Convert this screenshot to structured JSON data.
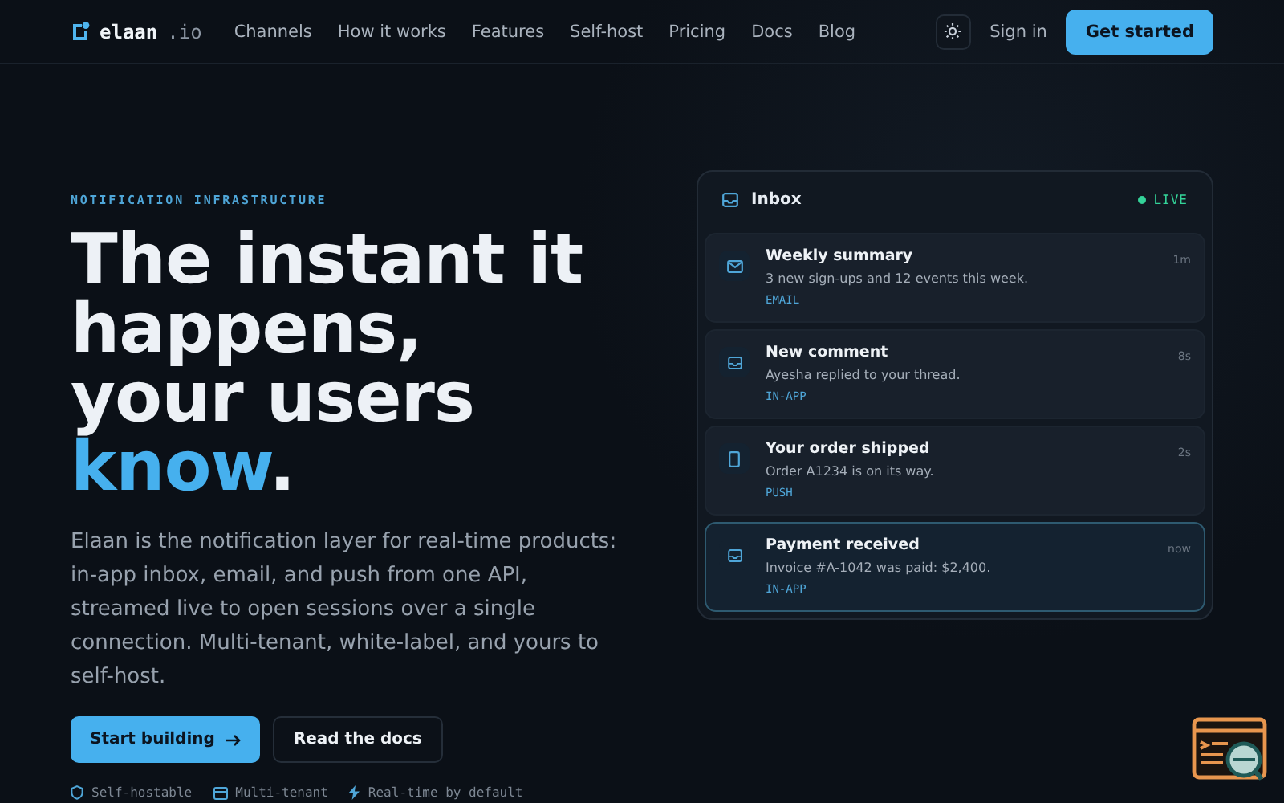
{
  "nav": {
    "logo": {
      "name": "elaan",
      "suffix": ".io"
    },
    "links": [
      "Channels",
      "How it works",
      "Features",
      "Self-host",
      "Pricing",
      "Docs",
      "Blog"
    ],
    "sign_in": "Sign in",
    "cta": "Get started"
  },
  "hero": {
    "eyebrow": "NOTIFICATION INFRASTRUCTURE",
    "headline": {
      "before": "The instant it happens, your users ",
      "highlight": "know",
      "after": "."
    },
    "description": "Elaan is the notification layer for real-time products: in-app inbox, email, and push from one API, streamed live to open sessions over a single connection. Multi-tenant, white-label, and yours to self-host.",
    "buttons": [
      {
        "label": "Start building",
        "kind": "primary"
      },
      {
        "label": "Read the docs",
        "kind": "secondary"
      }
    ],
    "features": [
      {
        "label": "Self-hostable",
        "kind": "shield"
      },
      {
        "label": "Multi-tenant",
        "kind": "tenant"
      },
      {
        "label": "Real-time by default",
        "kind": "bolt"
      }
    ]
  },
  "inbox": {
    "title": "Inbox",
    "status": "LIVE",
    "notifications": [
      {
        "title": "Weekly summary",
        "body": "3 new sign-ups and 12 events this week.",
        "channel": "EMAIL",
        "kind": "email",
        "time": "1m",
        "selected": false
      },
      {
        "title": "New comment",
        "body": "Ayesha replied to your thread.",
        "channel": "IN-APP",
        "kind": "inapp",
        "time": "8s",
        "selected": false
      },
      {
        "title": "Your order shipped",
        "body": "Order A1234 is on its way.",
        "channel": "PUSH",
        "kind": "push",
        "time": "2s",
        "selected": false
      },
      {
        "title": "Payment received",
        "body": "Invoice #A-1042 was paid: $2,400.",
        "channel": "IN-APP",
        "kind": "inapp",
        "time": "now",
        "selected": true
      }
    ]
  }
}
